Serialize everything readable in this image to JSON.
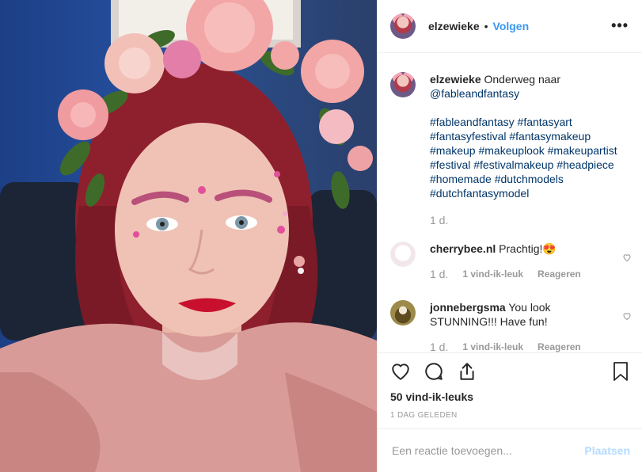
{
  "header": {
    "username": "elzewieke",
    "separator": "•",
    "follow_label": "Volgen",
    "more_label": "•••"
  },
  "caption": {
    "username": "elzewieke",
    "text": "Onderweg naar",
    "mention": "@fableandfantasy",
    "hashtags": "#fableandfantasy #fantasyart #fantasyfestival #fantasymakeup #makeup #makeuplook #makeupartist #festival #festivalmakeup #headpiece #homemade #dutchmodels #dutchfantasymodel",
    "time": "1 d."
  },
  "comments": [
    {
      "username": "cherrybee.nl",
      "text": "Prachtig!😍",
      "time": "1 d.",
      "likes": "1 vind-ik-leuk",
      "reply_label": "Reageren"
    },
    {
      "username": "jonnebergsma",
      "text": "You look STUNNING!!! Have fun!",
      "time": "1 d.",
      "likes": "1 vind-ik-leuk",
      "reply_label": "Reageren"
    }
  ],
  "actions": {
    "likes_count": "50 vind-ik-leuks",
    "date": "1 DAG GELEDEN"
  },
  "add_comment": {
    "placeholder": "Een reactie toevoegen...",
    "post_label": "Plaatsen"
  },
  "icons": {
    "like": "heart-icon",
    "comment": "comment-icon",
    "share": "share-icon",
    "save": "bookmark-icon",
    "more": "more-icon"
  },
  "colors": {
    "link": "#3897f0",
    "hashtag": "#003569",
    "post_disabled": "#b3dbff",
    "muted": "#999999"
  }
}
